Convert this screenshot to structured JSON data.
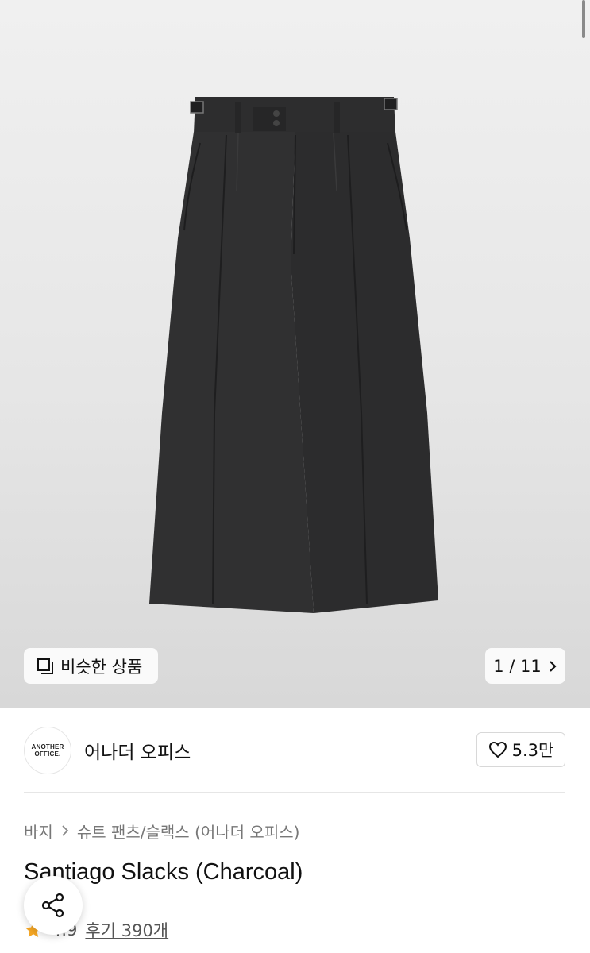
{
  "gallery": {
    "similar_label": "비슷한 상품",
    "counter": "1 / 11"
  },
  "brand": {
    "logo_line1": "ANOTHER",
    "logo_line2": "OFFICE.",
    "name": "어나더 오피스",
    "likes": "5.3만"
  },
  "breadcrumb": {
    "items": [
      "바지",
      "슈트 팬츠/슬랙스 (어나더 오피스)"
    ]
  },
  "product": {
    "title": "Santiago Slacks (Charcoal)",
    "rating": "4.9",
    "reviews": "후기 390개"
  },
  "colors": {
    "star": "#f5a623",
    "pants": "#2f2f30"
  },
  "icons": {
    "similar": "copy-squares-icon",
    "counter": "chevron-right-icon",
    "like": "heart-outline-icon",
    "share": "share-icon",
    "rating": "star-icon"
  }
}
